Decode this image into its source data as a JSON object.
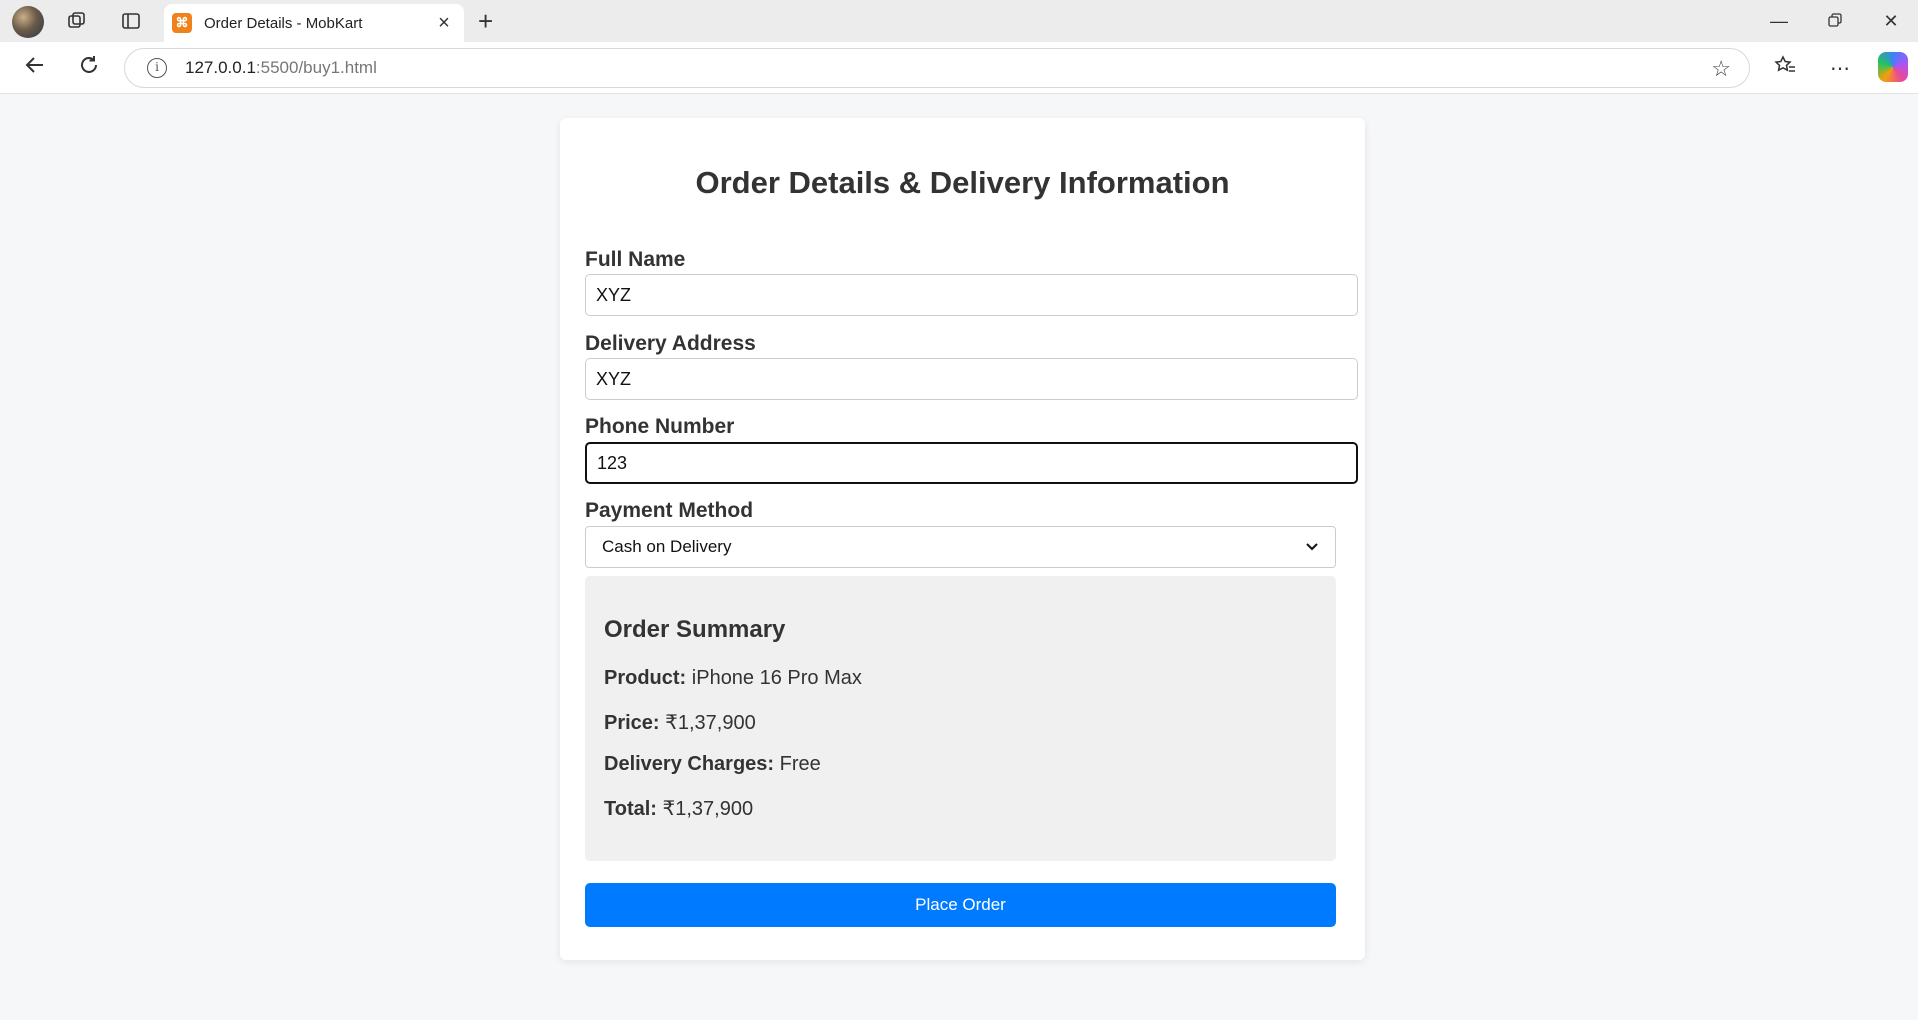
{
  "browser": {
    "tab_title": "Order Details - MobKart",
    "tab_favicon": "xampp-icon",
    "url_host": "127.0.0.1",
    "url_path": ":5500/buy1.html"
  },
  "form": {
    "title": "Order Details & Delivery Information",
    "full_name_label": "Full Name",
    "full_name_value": "XYZ",
    "address_label": "Delivery Address",
    "address_value": "XYZ",
    "phone_label": "Phone Number",
    "phone_value": "123",
    "payment_label": "Payment Method",
    "payment_value": "Cash on Delivery"
  },
  "summary": {
    "title": "Order Summary",
    "product_label": "Product:",
    "product_value": "iPhone 16 Pro Max",
    "price_label": "Price:",
    "price_value": "₹1,37,900",
    "delivery_label": "Delivery Charges:",
    "delivery_value": "Free",
    "total_label": "Total:",
    "total_value": "₹1,37,900"
  },
  "actions": {
    "place_order": "Place Order"
  },
  "colors": {
    "accent": "#007bff",
    "page_bg": "#f6f7f9",
    "summary_bg": "#f0f0f0"
  }
}
